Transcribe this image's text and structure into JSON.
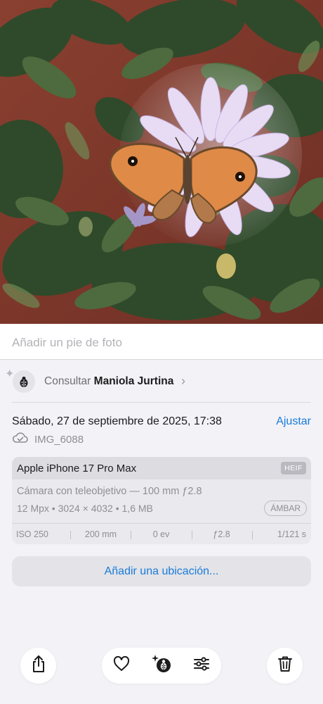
{
  "photo": {
    "subject": "butterfly-on-daisy"
  },
  "caption": {
    "placeholder": "Añadir un pie de foto"
  },
  "lookup": {
    "prefix": "Consultar",
    "name": "Maniola Jurtina",
    "icon": "ladybug-icon"
  },
  "info": {
    "date": "Sábado, 27 de septiembre de 2025, 17:38",
    "adjust_label": "Ajustar",
    "filename": "IMG_6088",
    "cloud_icon": "cloud-check-icon"
  },
  "camera": {
    "model": "Apple iPhone 17 Pro Max",
    "format": "HEIF",
    "lens": "Cámara con teleobjetivo — 100 mm ƒ2.8",
    "specs": "12 Mpx • 3024 × 4032 • 1,6 MB",
    "profile": "ÁMBAR",
    "exif": [
      "ISO 250",
      "200 mm",
      "0 ev",
      "ƒ2.8",
      "1/121 s"
    ]
  },
  "location": {
    "label": "Añadir una ubicación..."
  },
  "toolbar": {
    "share": "share-icon",
    "favorite": "heart-icon",
    "visual_lookup": "ladybug-sparkle-icon",
    "adjust": "sliders-icon",
    "delete": "trash-icon"
  },
  "colors": {
    "accent": "#1a7bd8",
    "background": "#f2f2f7"
  }
}
